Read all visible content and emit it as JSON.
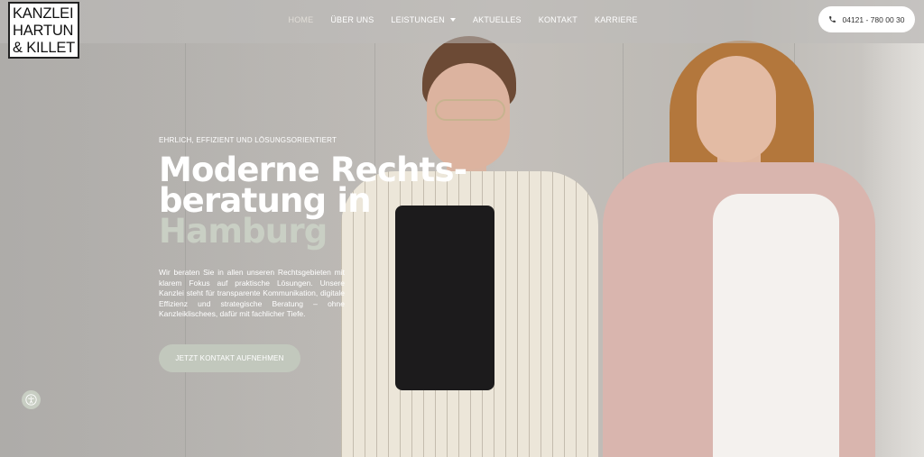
{
  "logo": {
    "lines": [
      "KANZLEI",
      "HARTUN",
      "& KILLET"
    ]
  },
  "nav": {
    "items": [
      {
        "label": "HOME",
        "active": true
      },
      {
        "label": "ÜBER UNS"
      },
      {
        "label": "LEISTUNGEN",
        "has_dropdown": true
      },
      {
        "label": "AKTUELLES"
      },
      {
        "label": "KONTAKT"
      },
      {
        "label": "KARRIERE"
      }
    ]
  },
  "phone": {
    "label": "04121 - 780 00 30",
    "icon": "phone-icon"
  },
  "hero": {
    "eyebrow": "EHRLICH, EFFIZIENT UND LÖSUNGSORIENTIERT",
    "headline": [
      "Moderne Rechts-",
      "beratung in"
    ],
    "headline_accent": "Hamburg",
    "lead": "Wir beraten Sie in allen unseren Rechtsgebieten mit klarem Fokus auf praktische Lösungen. Unsere Kanzlei steht für transparente Kommunikation, digitale Effizienz und strategische Beratung – ohne Kanzleiklischees, dafür mit fachlicher Tiefe.",
    "cta": "JETZT KONTAKT AUFNEHMEN"
  },
  "accessibility": {
    "icon": "accessibility-icon"
  },
  "colors": {
    "accent": "#c2c8bd",
    "headline_accent": "#c9cfc4",
    "white": "#ffffff"
  }
}
